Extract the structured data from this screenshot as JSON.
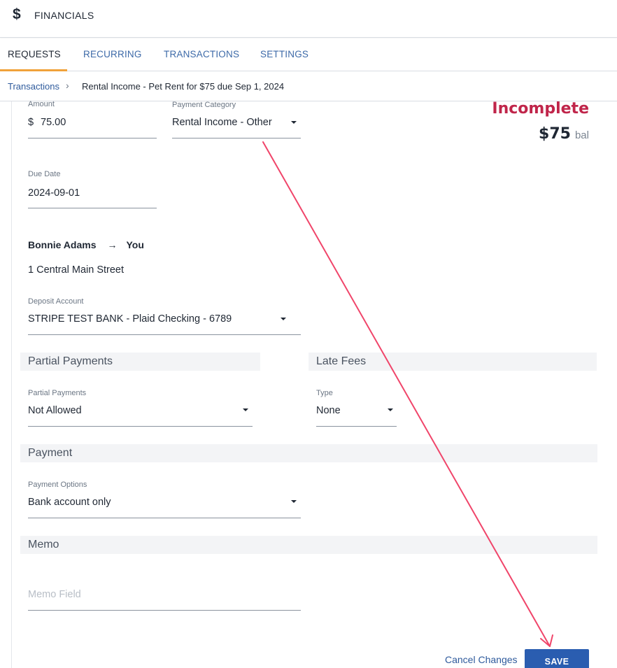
{
  "header": {
    "icon": "dollar-icon",
    "title": "FINANCIALS"
  },
  "tabs": [
    {
      "label": "REQUESTS",
      "active": true
    },
    {
      "label": "RECURRING",
      "active": false
    },
    {
      "label": "TRANSACTIONS",
      "active": false
    },
    {
      "label": "SETTINGS",
      "active": false
    }
  ],
  "breadcrumb": {
    "parent": "Transactions",
    "separator": "›",
    "current": "Rental Income - Pet Rent for $75 due Sep 1, 2024"
  },
  "form": {
    "amount": {
      "label": "Amount",
      "currency": "$",
      "value": "75.00"
    },
    "payment_category": {
      "label": "Payment Category",
      "value": "Rental Income - Other"
    },
    "due_date": {
      "label": "Due Date",
      "value": "2024-09-01"
    },
    "parties": {
      "from": "Bonnie Adams",
      "arrow": "→",
      "to": "You"
    },
    "address": "1 Central Main Street",
    "deposit_account": {
      "label": "Deposit Account",
      "value": "STRIPE TEST BANK - Plaid Checking - 6789"
    },
    "partial_payments_section": "Partial Payments",
    "partial_payments": {
      "label": "Partial Payments",
      "value": "Not Allowed"
    },
    "late_fees_section": "Late Fees",
    "late_fee_type": {
      "label": "Type",
      "value": "None"
    },
    "payment_section": "Payment",
    "payment_options": {
      "label": "Payment Options",
      "value": "Bank account only"
    },
    "memo_section": "Memo",
    "memo": {
      "placeholder": "Memo Field",
      "value": ""
    }
  },
  "status": {
    "label": "Incomplete",
    "amount": "$75",
    "suffix": "bal",
    "color": "#c0254a"
  },
  "actions": {
    "cancel_label": "Cancel Changes",
    "save_label": "SAVE"
  },
  "colors": {
    "accent": "#2a5db0",
    "tab_indicator": "#f0a23a",
    "link": "#2e5a9c",
    "annotation_arrow": "#f0456a"
  }
}
